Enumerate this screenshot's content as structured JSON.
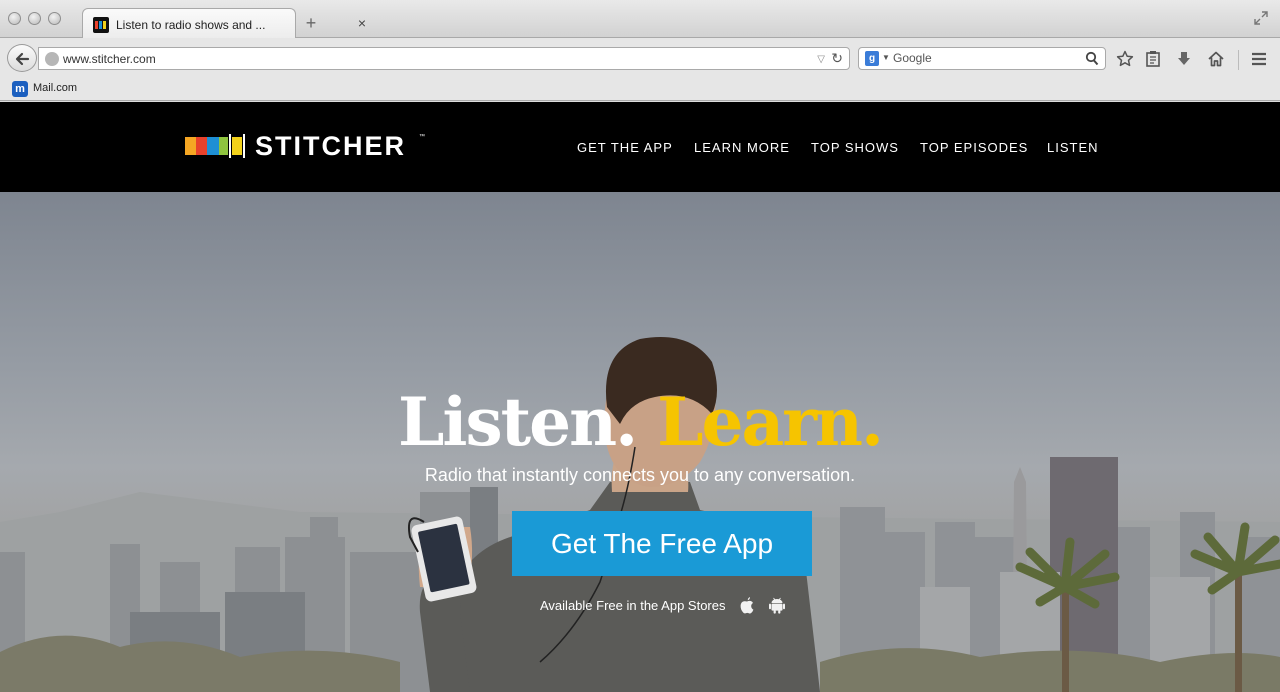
{
  "browser": {
    "tab_title": "Listen to radio shows and ...",
    "tab_close": "×",
    "new_tab": "+",
    "url": "www.stitcher.com",
    "search_placeholder": "Google",
    "search_engine_badge": "g",
    "bookmarks": [
      {
        "label": "Mail.com",
        "icon": "mail-com-icon",
        "icon_text": "m"
      }
    ]
  },
  "site": {
    "logo_text": "STITCHER",
    "logo_tm": "™",
    "nav": [
      {
        "label": "GET THE APP"
      },
      {
        "label": "LEARN MORE"
      },
      {
        "label": "TOP SHOWS"
      },
      {
        "label": "TOP EPISODES"
      },
      {
        "label": "LISTEN"
      }
    ]
  },
  "hero": {
    "headline_part1": "Listen.",
    "headline_part2": "Learn.",
    "subheadline": "Radio that instantly connects you to any conversation.",
    "cta_label": "Get The Free App",
    "stores_text": "Available Free in the App Stores"
  },
  "colors": {
    "header_bg": "#000000",
    "accent_yellow": "#f6c400",
    "cta_blue": "#1a9ad6",
    "logo_bars": [
      "#f5a623",
      "#e8412b",
      "#1e8fd4",
      "#8fc43f",
      "#f3d21a"
    ]
  }
}
